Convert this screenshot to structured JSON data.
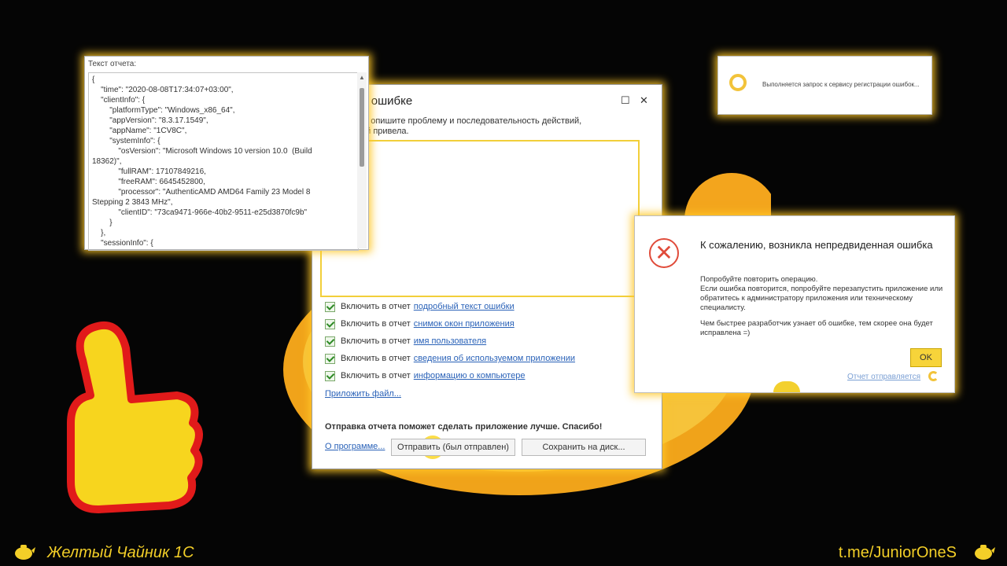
{
  "report_dialog": {
    "title": "б ошибке",
    "desc_line1": "а, опишите проблему и последовательность действий,",
    "desc_line2": "ей привела.",
    "checks": [
      {
        "prefix": "Включить в отчет",
        "link": "подробный текст ошибки"
      },
      {
        "prefix": "Включить в отчет",
        "link": "снимок окон приложения"
      },
      {
        "prefix": "Включить в отчет",
        "link": "имя пользователя"
      },
      {
        "prefix": "Включить в отчет",
        "link": "сведения об используемом приложении"
      },
      {
        "prefix": "Включить в отчет",
        "link": "информацию о компьютере"
      }
    ],
    "attach_label": "Приложить файл...",
    "thanks_text": "Отправка отчета поможет сделать приложение лучше. Спасибо!",
    "about_label": "О программе...",
    "send_label": "Отправить (был отправлен)",
    "save_label": "Сохранить на диск..."
  },
  "report_text": {
    "label": "Текст отчета:",
    "content": "{\n    \"time\": \"2020-08-08T17:34:07+03:00\",\n    \"clientInfo\": {\n        \"platformType\": \"Windows_x86_64\",\n        \"appVersion\": \"8.3.17.1549\",\n        \"appName\": \"1CV8C\",\n        \"systemInfo\": {\n            \"osVersion\": \"Microsoft Windows 10 version 10.0  (Build\n18362)\",\n            \"fullRAM\": 17107849216,\n            \"freeRAM\": 6645452800,\n            \"processor\": \"AuthenticAMD AMD64 Family 23 Model 8\nStepping 2 3843 MHz\",\n            \"clientID\": \"73ca9471-966e-40b2-9511-e25d3870fc9b\"\n        }\n    },\n    \"sessionInfo\": {"
  },
  "progress": {
    "text": "Выполняется запрос к сервису регистрации ошибок..."
  },
  "error_dialog": {
    "title": "К сожалению, возникла непредвиденная ошибка",
    "para1_line1": "Попробуйте повторить операцию.",
    "para1_line2": "Если ошибка повторится, попробуйте перезапустить приложение или обратитесь к администратору приложения или техническому специалисту.",
    "para2": "Чем быстрее разработчик узнает об ошибке, тем скорее она будет исправлена =)",
    "ok_label": "OK",
    "report_status_link": "Отчет отправляется"
  },
  "footer": {
    "left_text": "Желтый Чайник 1С",
    "right_text": "t.me/JuniorOneS"
  },
  "colors": {
    "accent_yellow": "#f3cf28",
    "link_blue": "#2a62b8",
    "error_red": "#e04b3a"
  }
}
